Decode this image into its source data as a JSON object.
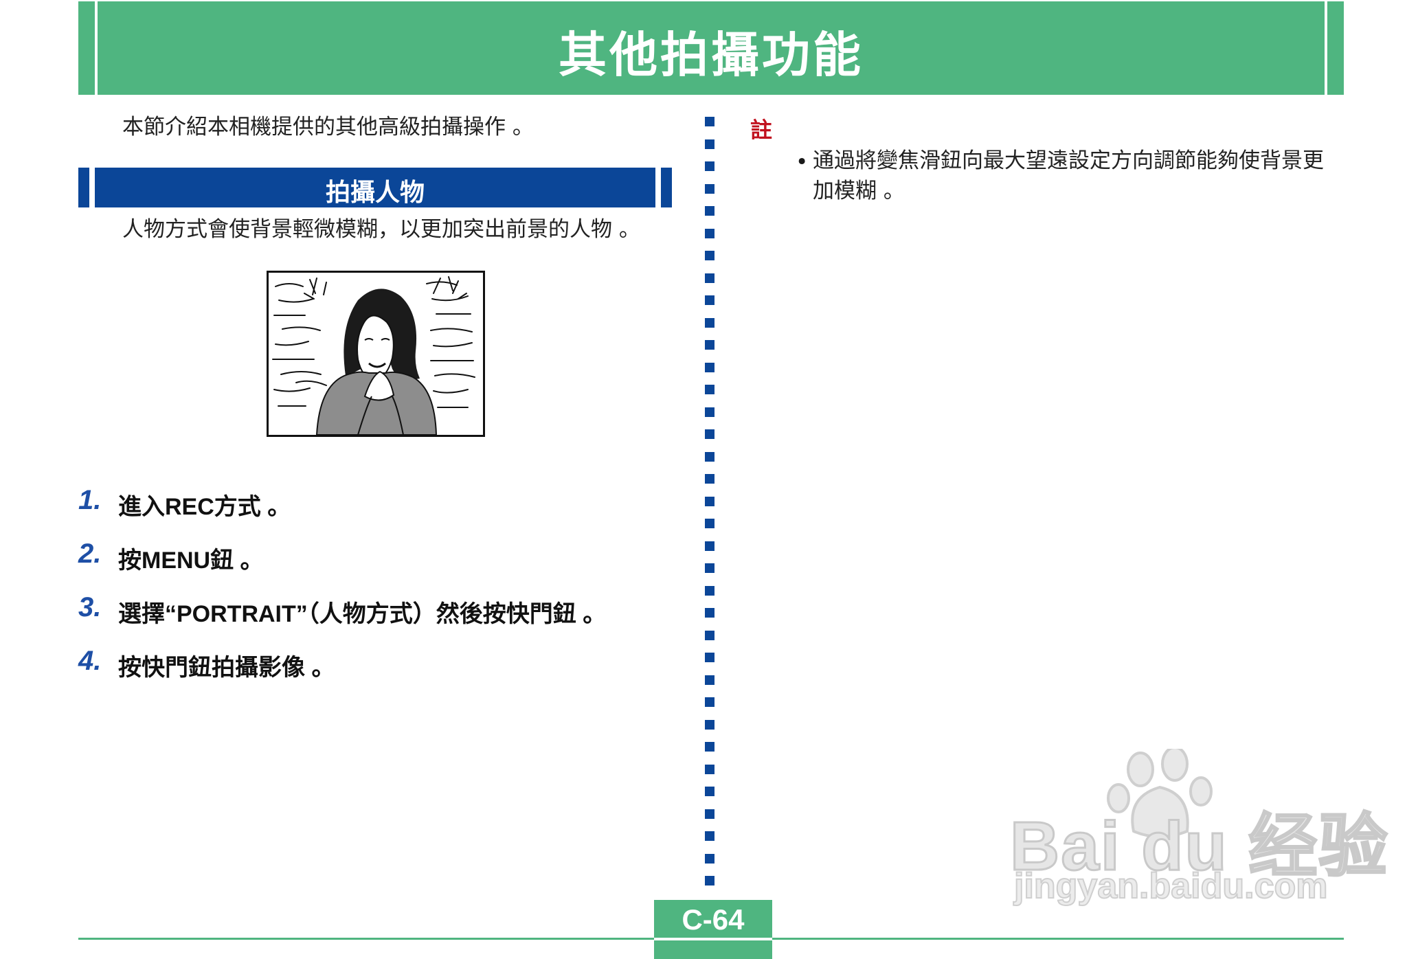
{
  "header": {
    "title": "其他拍攝功能"
  },
  "intro": {
    "text": "本節介紹本相機提供的其他高級拍攝操作 。"
  },
  "section": {
    "title": "拍攝人物",
    "description": "人物方式會使背景輕微模糊，以更加突出前景的人物 。"
  },
  "steps": [
    {
      "number": "1.",
      "text": "進入REC方式 。"
    },
    {
      "number": "2.",
      "text": "按MENU鈕 。"
    },
    {
      "number": "3.",
      "text": "選擇“PORTRAIT”（人物方式）然後按快門鈕 。"
    },
    {
      "number": "4.",
      "text": "按快門鈕拍攝影像 。"
    }
  ],
  "note": {
    "label": "註",
    "bullet": "•",
    "line1": "通過將變焦滑鈕向最大望遠設定方向調節能夠使背景更",
    "line2": "加模糊 。"
  },
  "footer": {
    "page_number": "C-64"
  },
  "watermark": {
    "brand": "Bai du 经验",
    "url": "jingyan.baidu.com"
  },
  "colors": {
    "green": "#4fb580",
    "blue": "#0b4698",
    "step_number": "#1e4fa6",
    "note_red": "#c1121f"
  },
  "icons": {
    "portrait_illustration": "woman-portrait-line-drawing",
    "watermark_logo": "baidu-paw-icon"
  }
}
